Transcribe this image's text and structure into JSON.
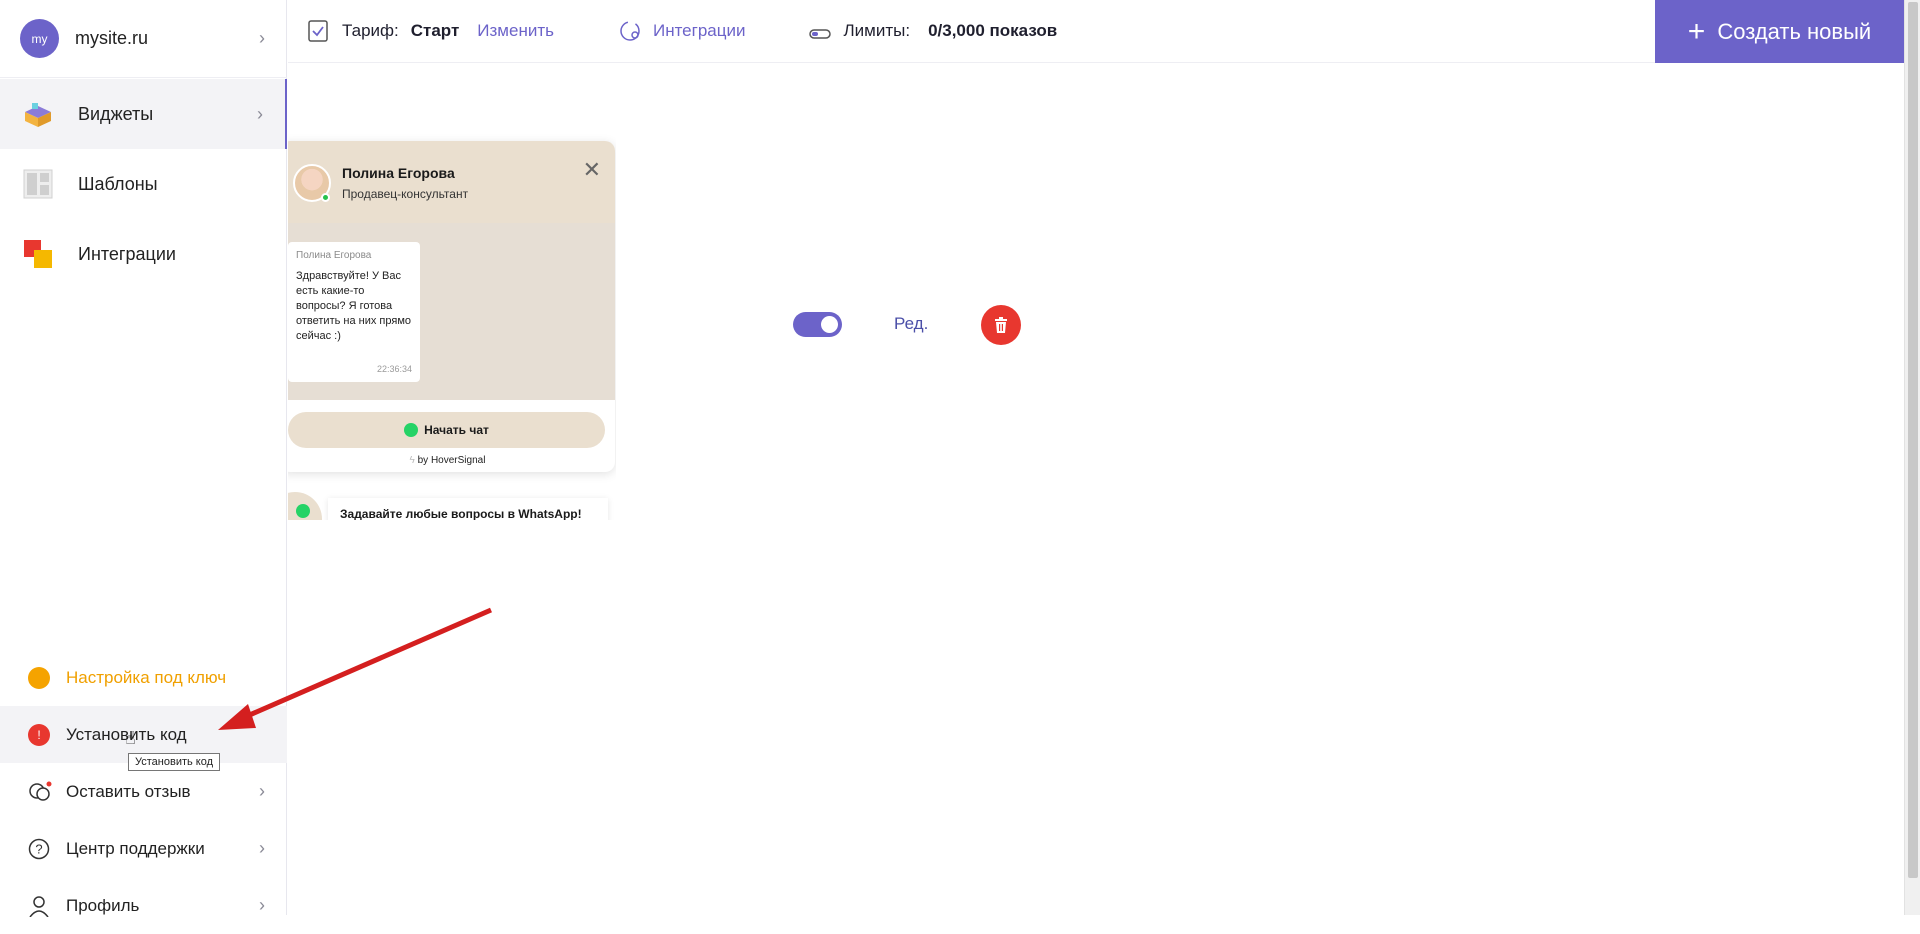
{
  "sidebar": {
    "site": {
      "avatar_text": "my",
      "name": "mysite.ru"
    },
    "nav": [
      {
        "label": "Виджеты",
        "icon": "widgets-box-icon"
      },
      {
        "label": "Шаблоны",
        "icon": "templates-grid-icon"
      },
      {
        "label": "Интеграции",
        "icon": "integrations-squares-icon"
      }
    ],
    "bottom": [
      {
        "label": "Настройка под ключ",
        "icon": "orange-dot-icon"
      },
      {
        "label": "Установить код",
        "icon": "red-alert-icon"
      },
      {
        "label": "Оставить отзыв",
        "icon": "chat-bubbles-icon"
      },
      {
        "label": "Центр поддержки",
        "icon": "help-circle-icon"
      },
      {
        "label": "Профиль",
        "icon": "user-icon"
      }
    ],
    "tooltip": "Установить код"
  },
  "topbar": {
    "tariff_label": "Тариф:",
    "tariff_value": "Старт",
    "tariff_change": "Изменить",
    "integrations": "Интеграции",
    "limits_label": "Лимиты:",
    "limits_value": "0/3,000 показов",
    "create_button": "Создать новый"
  },
  "widget": {
    "agent_name": "Полина Егорова",
    "agent_role": "Продавец-консультант",
    "message_author": "Полина Егорова",
    "message_text": "Здравствуйте! У Вас есть какие-то вопросы? Я готова ответить на них прямо сейчас :)",
    "message_time": "22:36:34",
    "start_chat": "Начать чат",
    "powered_by": "by HoverSignal",
    "teaser": "Задавайте любые вопросы в WhatsApp!"
  },
  "controls": {
    "toggle_on": true,
    "edit_label": "Ред."
  },
  "colors": {
    "accent": "#6c63c9",
    "danger": "#e8372f",
    "warning": "#f5a300",
    "widget_beige": "#eadfcf"
  }
}
